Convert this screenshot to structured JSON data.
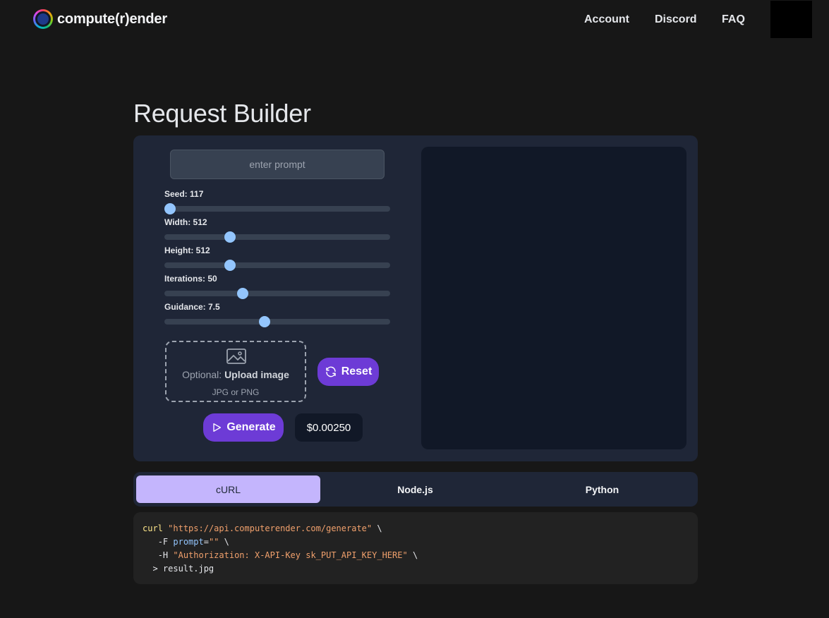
{
  "header": {
    "brand": "compute(r)ender",
    "nav": [
      {
        "label": "Account"
      },
      {
        "label": "Discord"
      },
      {
        "label": "FAQ"
      }
    ]
  },
  "page": {
    "title": "Request Builder"
  },
  "builder": {
    "prompt_placeholder": "enter prompt",
    "sliders": [
      {
        "label": "Seed: 117",
        "level": 0.0
      },
      {
        "label": "Width: 512",
        "level": 0.28
      },
      {
        "label": "Height: 512",
        "level": 0.28
      },
      {
        "label": "Iterations: 50",
        "level": 0.34
      },
      {
        "label": "Guidance: 7.5",
        "level": 0.44
      }
    ],
    "upload": {
      "prefix": "Optional:",
      "action": "Upload image",
      "formats": "JPG or PNG"
    },
    "reset_label": "Reset",
    "generate_label": "Generate",
    "price": "$0.00250"
  },
  "tabs": [
    {
      "label": "cURL",
      "active": true
    },
    {
      "label": "Node.js",
      "active": false
    },
    {
      "label": "Python",
      "active": false
    }
  ],
  "code": {
    "cmd": "curl",
    "url": "\"https://api.computerender.com/generate\"",
    "cont": " \\",
    "flag_f": "-F",
    "prompt_key": "prompt",
    "prompt_eq": "=",
    "prompt_val": "\"\"",
    "flag_h": "-H",
    "auth": "\"Authorization: X-API-Key sk_PUT_API_KEY_HERE\"",
    "redirect": "> result.jpg"
  },
  "colors": {
    "accent": "#6d3bd6",
    "tab_active": "#c4b5fd",
    "slider_thumb": "#93c5fd"
  }
}
